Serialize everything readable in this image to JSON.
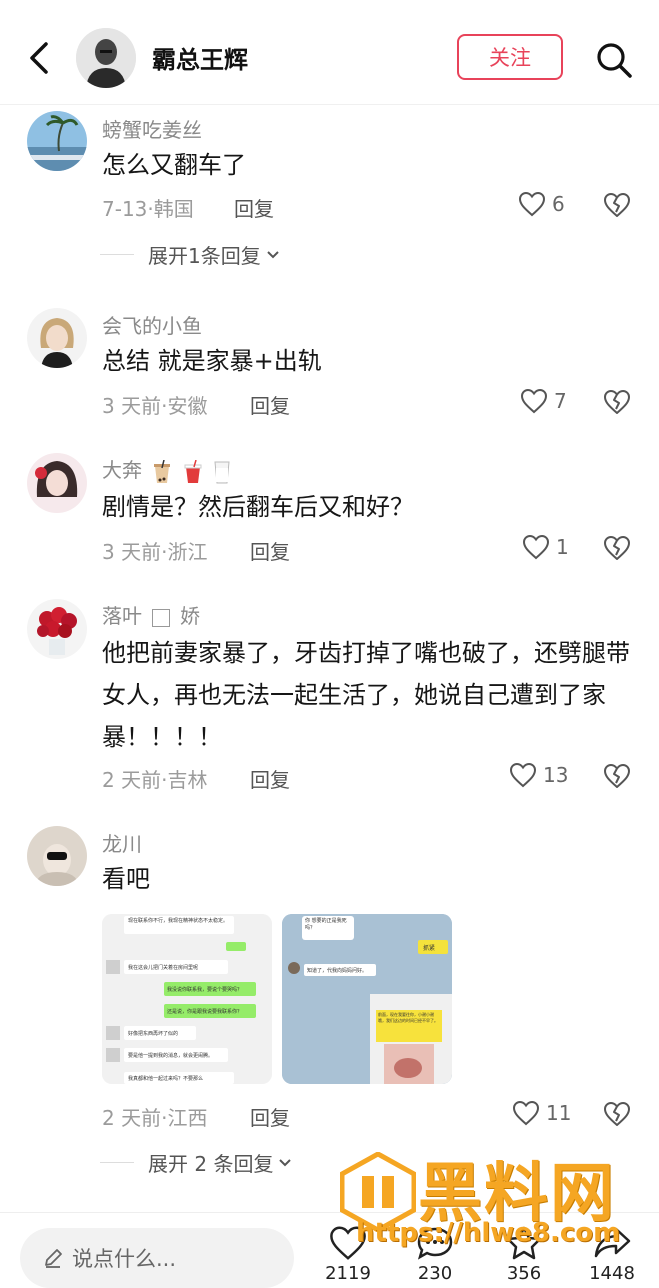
{
  "header": {
    "name": "霸总王辉",
    "follow_label": "关注"
  },
  "comments": [
    {
      "user": "螃蟹吃姜丝",
      "text": "怎么又翻车了",
      "date": "7-13",
      "location": "韩国",
      "likes": "6",
      "reply_label": "回复",
      "expand_label": "展开1条回复"
    },
    {
      "user": "会飞的小鱼",
      "text": "总结 就是家暴+出轨",
      "date": "3 天前",
      "location": "安徽",
      "likes": "7",
      "reply_label": "回复"
    },
    {
      "user": "大奔",
      "text": "剧情是？然后翻车后又和好？",
      "date": "3 天前",
      "location": "浙江",
      "likes": "1",
      "reply_label": "回复"
    },
    {
      "user_a": "落叶",
      "user_b": "娇",
      "text": "他把前妻家暴了，牙齿打掉了嘴也破了，还劈腿带女人，再也无法一起生活了，她说自己遭到了家暴！！！！",
      "date": "2 天前",
      "location": "吉林",
      "likes": "13",
      "reply_label": "回复"
    },
    {
      "user": "龙川",
      "text": "看吧",
      "date": "2 天前",
      "location": "江西",
      "likes": "11",
      "reply_label": "回复",
      "expand_label": "展开 2 条回复"
    }
  ],
  "chat_image_1": {
    "lines": [
      "现在联系你不行，我现在精神状态不太稳定。",
      "我在这会儿把门关着在房间里呢",
      "我没说你联系我，要说个要哭吗？",
      "还是说，你是跟我说要我联系你？",
      "好像把东西再坏了似的",
      "要是他一提到我的消息，就会更闹腾。",
      "我真都和他一起过来吗？不要那么"
    ]
  },
  "chat_image_2": {
    "lines": [
      "你 想要的正是我死吗？",
      "抓紧",
      "知道了，代我向妈妈问好。",
      "前面，现在我要往你，小谢小谢哦，我们这边的时间已经不早了。"
    ]
  },
  "bottom": {
    "input_placeholder": "说点什么...",
    "like_count": "2119",
    "comment_count": "230",
    "star_count": "356",
    "share_count": "1448"
  },
  "watermark": {
    "text": "黑料网",
    "url": "https://hlwe8.com"
  },
  "dot_separator": "·",
  "colors": {
    "accent": "#e8435a",
    "watermark": "#f5a623"
  }
}
